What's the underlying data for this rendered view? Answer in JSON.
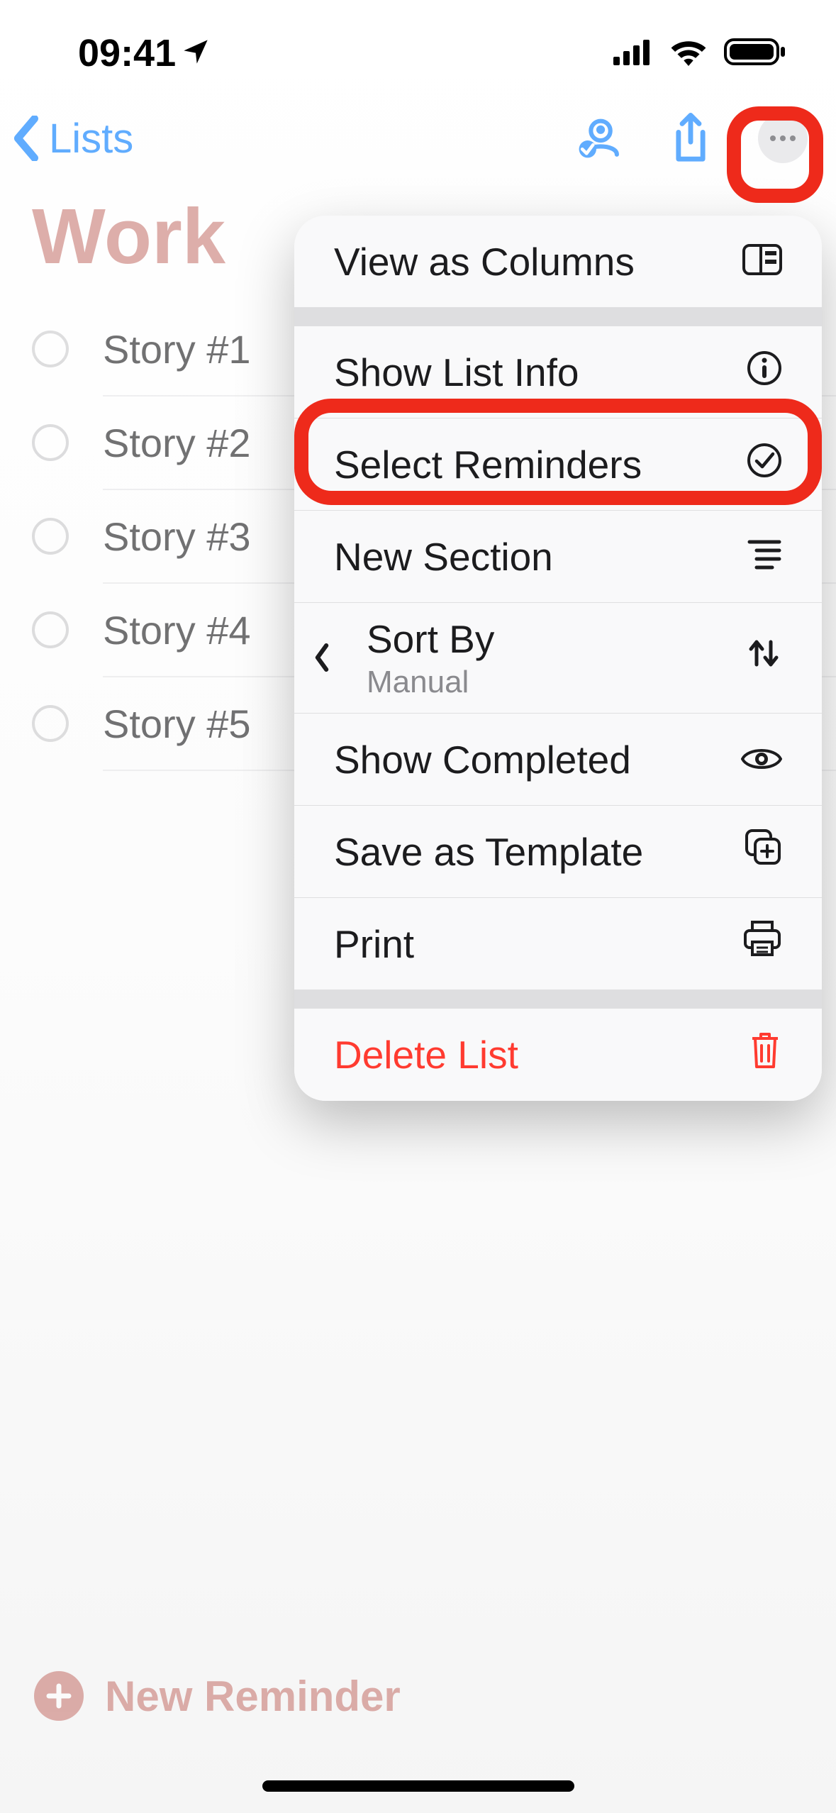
{
  "status": {
    "time": "09:41"
  },
  "nav": {
    "back_label": "Lists"
  },
  "list": {
    "title": "Work",
    "items": [
      {
        "title": "Story #1"
      },
      {
        "title": "Story #2"
      },
      {
        "title": "Story #3"
      },
      {
        "title": "Story #4"
      },
      {
        "title": "Story #5"
      }
    ]
  },
  "menu": {
    "view_columns": "View as Columns",
    "show_list_info": "Show List Info",
    "select_reminders": "Select Reminders",
    "new_section": "New Section",
    "sort_by": "Sort By",
    "sort_by_value": "Manual",
    "show_completed": "Show Completed",
    "save_template": "Save as Template",
    "print": "Print",
    "delete_list": "Delete List"
  },
  "footer": {
    "new_reminder": "New Reminder"
  }
}
